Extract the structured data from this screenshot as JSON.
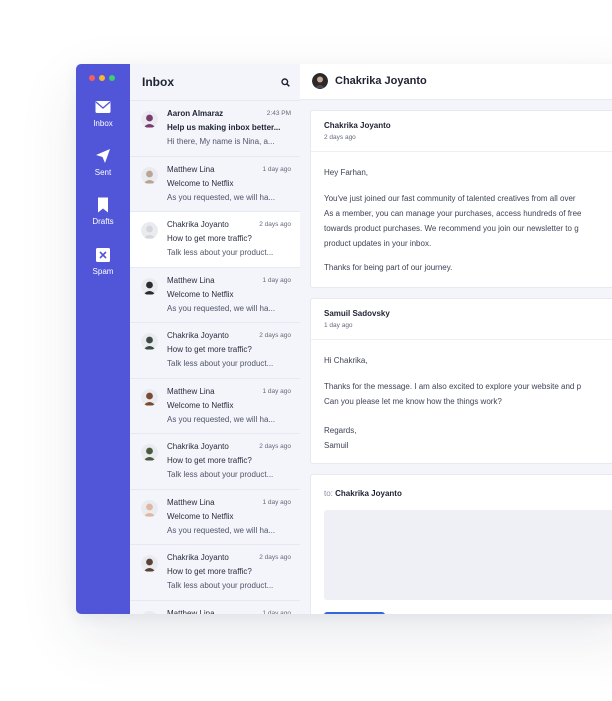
{
  "window_dots": [
    "#f25f5c",
    "#f7b731",
    "#3ccf6e"
  ],
  "sidebar": {
    "items": [
      {
        "label": "Inbox",
        "icon": "mail-icon"
      },
      {
        "label": "Sent",
        "icon": "send-icon"
      },
      {
        "label": "Drafts",
        "icon": "bookmark-icon"
      },
      {
        "label": "Spam",
        "icon": "close-box-icon"
      }
    ]
  },
  "inbox": {
    "title": "Inbox",
    "items": [
      {
        "name": "Aaron Almaraz",
        "time": "2:43 PM",
        "subject": "Help us making inbox better...",
        "preview": "Hi there, My name is Nina, a...",
        "unread": true,
        "selected": false,
        "avatar_color": "#7a3b6e"
      },
      {
        "name": "Matthew Lina",
        "time": "1 day ago",
        "subject": "Welcome to Netflix",
        "preview": "As you requested, we will ha...",
        "unread": false,
        "selected": false,
        "avatar_color": "#b9a596"
      },
      {
        "name": "Chakrika Joyanto",
        "time": "2 days ago",
        "subject": "How to get more traffic?",
        "preview": "Talk less about your product...",
        "unread": false,
        "selected": true,
        "avatar_color": "#d4d6dc"
      },
      {
        "name": "Matthew Lina",
        "time": "1 day ago",
        "subject": "Welcome to Netflix",
        "preview": "As you requested, we will ha...",
        "unread": false,
        "selected": false,
        "avatar_color": "#2b2b2e"
      },
      {
        "name": "Chakrika Joyanto",
        "time": "2 days ago",
        "subject": "How to get more traffic?",
        "preview": "Talk less about your product...",
        "unread": false,
        "selected": false,
        "avatar_color": "#3d4a44"
      },
      {
        "name": "Matthew Lina",
        "time": "1 day ago",
        "subject": "Welcome to Netflix",
        "preview": "As you requested, we will ha...",
        "unread": false,
        "selected": false,
        "avatar_color": "#7a4a30"
      },
      {
        "name": "Chakrika Joyanto",
        "time": "2 days ago",
        "subject": "How to get more traffic?",
        "preview": "Talk less about your product...",
        "unread": false,
        "selected": false,
        "avatar_color": "#4a5a3c"
      },
      {
        "name": "Matthew Lina",
        "time": "1 day ago",
        "subject": "Welcome to Netflix",
        "preview": "As you requested, we will ha...",
        "unread": false,
        "selected": false,
        "avatar_color": "#e0b7a0"
      },
      {
        "name": "Chakrika Joyanto",
        "time": "2 days ago",
        "subject": "How to get more traffic?",
        "preview": "Talk less about your product...",
        "unread": false,
        "selected": false,
        "avatar_color": "#5b4236"
      },
      {
        "name": "Matthew Lina",
        "time": "1 day ago",
        "subject": "",
        "preview": "",
        "unread": false,
        "selected": false,
        "avatar_color": "#26272b"
      }
    ]
  },
  "conversation": {
    "title": "Chakrika Joyanto",
    "messages": [
      {
        "from": "Chakrika Joyanto",
        "date": "2 days ago",
        "lines": [
          "Hey Farhan,",
          "You've just joined our fast community of talented creatives from all over",
          "As a member, you can manage your purchases, access hundreds of free",
          "towards product purchases. We recommend you join our newsletter to g",
          "product updates in your inbox.",
          "Thanks for being part of our journey."
        ]
      },
      {
        "from": "Samuil Sadovsky",
        "date": "1 day ago",
        "lines": [
          "Hi Chakrika,",
          "Thanks for the message. I am also excited to explore your website and p",
          "Can you please let me know how the things work?",
          "Regards,",
          "Samuil"
        ]
      }
    ],
    "reply": {
      "to_label": "to:",
      "to_name": "Chakrika Joyanto"
    }
  }
}
